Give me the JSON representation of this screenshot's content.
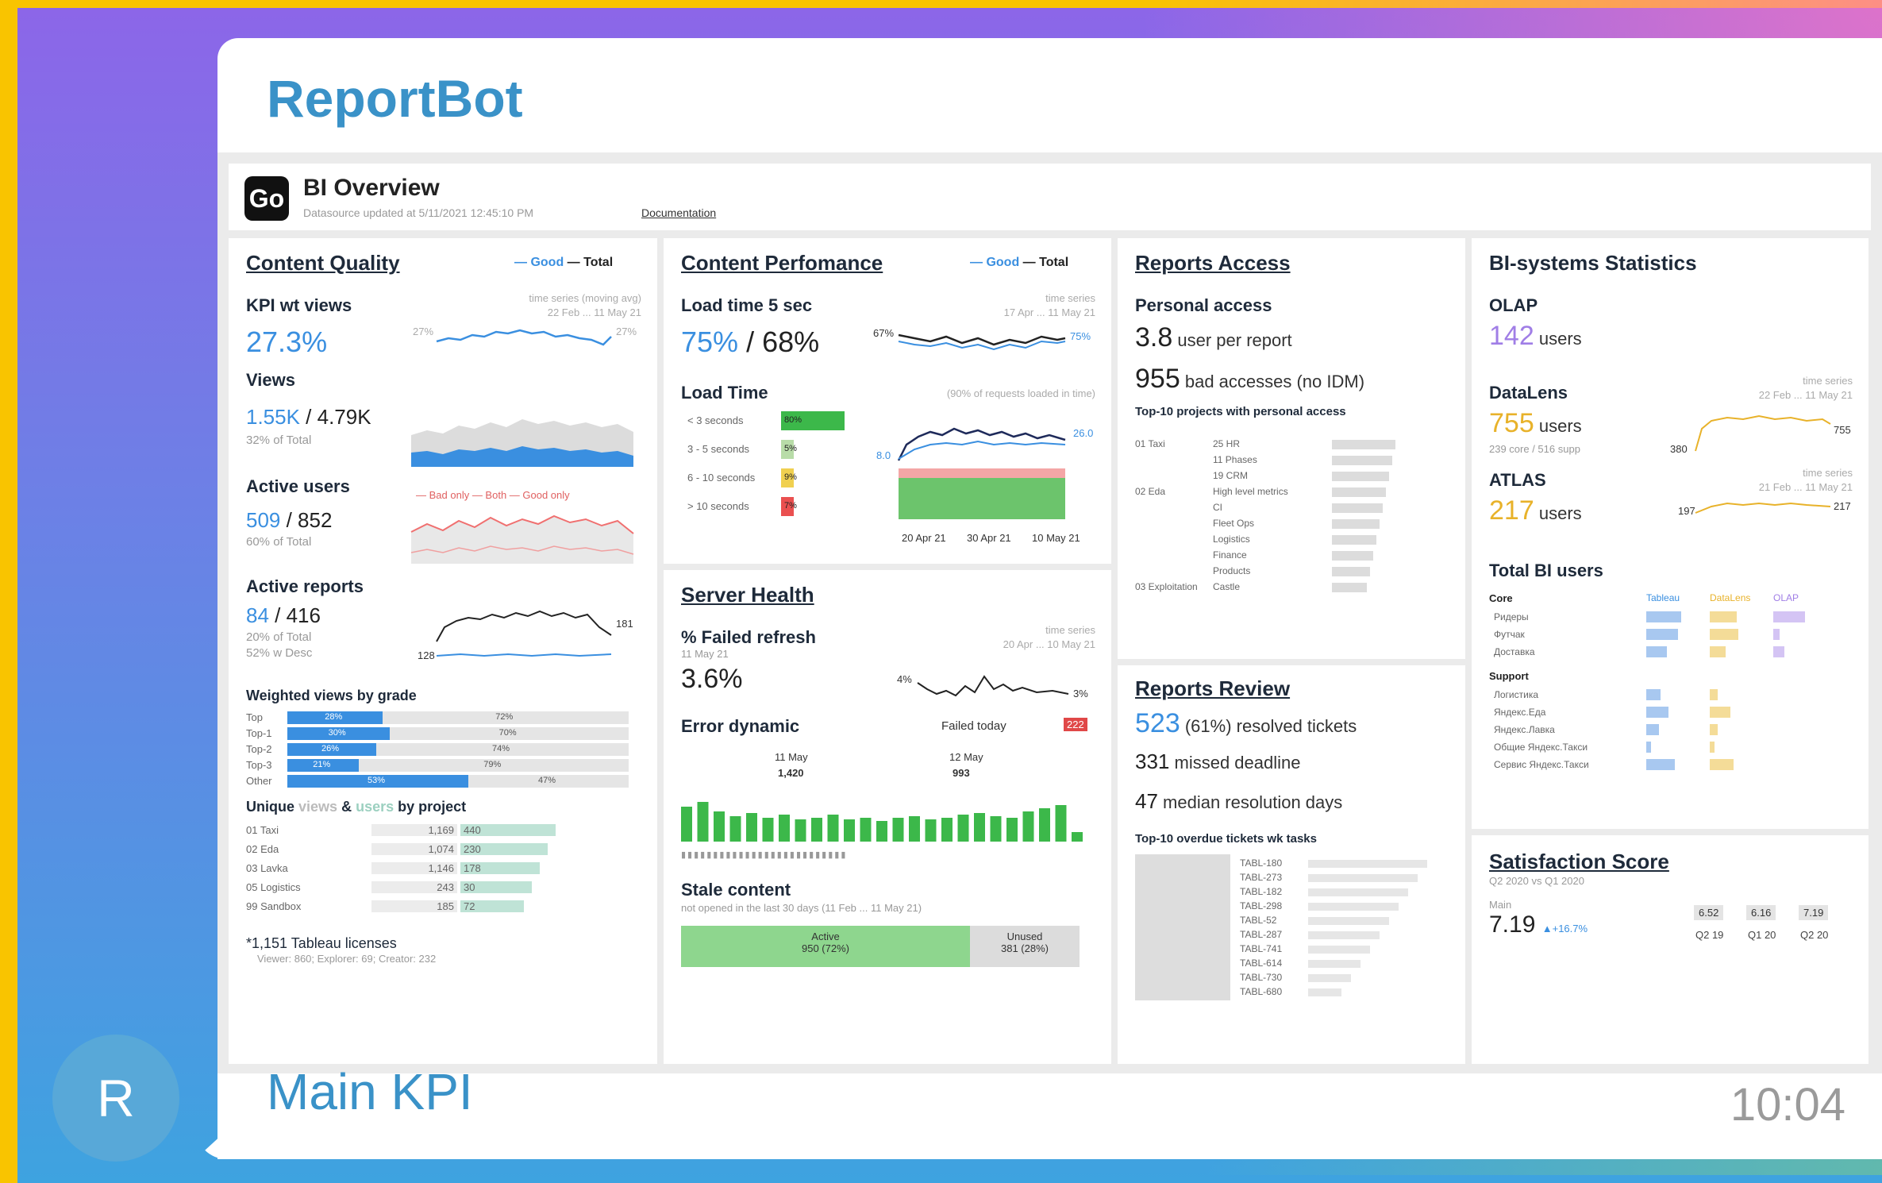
{
  "message": {
    "bot_name": "ReportBot",
    "avatar_letter": "R",
    "caption": "Main KPI",
    "time": "10:04"
  },
  "dashboard": {
    "logo": "Go",
    "title": "BI Overview",
    "subtitle": "Datasource updated at 5/11/2021 12:45:10 PM",
    "doc_link": "Documentation",
    "legend_good": "— Good",
    "legend_total": "— Total"
  },
  "content_quality": {
    "title": "Content Quality",
    "kpi_label": "KPI wt views",
    "kpi_value": "27.3%",
    "kpi_note": "time series (moving avg)",
    "kpi_range": "22 Feb ... 11 May 21",
    "kpi_start": "27%",
    "kpi_end": "27%",
    "views_label": "Views",
    "views_good": "1.55K",
    "views_total": " / 4.79K",
    "views_share": "32% of Total",
    "active_users_label": "Active users",
    "active_users_good": "509",
    "active_users_total": " / 852",
    "active_users_share": "60% of Total",
    "active_users_legend": "— Bad only — Both — Good only",
    "active_reports_label": "Active reports",
    "active_reports_good": "84",
    "active_reports_total": " / 416",
    "active_reports_share": "20% of Total",
    "active_reports_desc": "52% w Desc",
    "active_reports_end": "181",
    "active_reports_end2": "128",
    "grade_title": "Weighted views by grade",
    "grades": [
      {
        "label": "Top",
        "good": "28%",
        "total": "72%",
        "pct": 28
      },
      {
        "label": "Top-1",
        "good": "30%",
        "total": "70%",
        "pct": 30
      },
      {
        "label": "Top-2",
        "good": "26%",
        "total": "74%",
        "pct": 26
      },
      {
        "label": "Top-3",
        "good": "21%",
        "total": "79%",
        "pct": 21
      },
      {
        "label": "Other",
        "good": "53%",
        "total": "47%",
        "pct": 53
      }
    ],
    "unique_title_a": "Unique",
    "unique_title_b": "views",
    "unique_title_c": " & ",
    "unique_title_d": "users",
    "unique_title_e": " by project",
    "projects": [
      {
        "label": "01 Taxi",
        "views": "1,169",
        "users": "440"
      },
      {
        "label": "02 Eda",
        "views": "1,074",
        "users": "230"
      },
      {
        "label": "03 Lavka",
        "views": "1,146",
        "users": "178"
      },
      {
        "label": "05 Logistics",
        "views": "243",
        "users": "30"
      },
      {
        "label": "99 Sandbox",
        "views": "185",
        "users": "72"
      }
    ],
    "license_note": "*1,151 Tableau licenses",
    "license_detail": "Viewer: 860; Explorer: 69; Creator: 232"
  },
  "content_performance": {
    "title": "Content Perfomance",
    "load5_label": "Load time 5 sec",
    "load5_value": "75%",
    "load5_total": " / 68%",
    "load5_note": "time series",
    "load5_range": "17 Apr ... 11 May 21",
    "load5_start": "67%",
    "load5_end": "75%",
    "load_time_label": "Load Time",
    "load_time_note": "(90% of requests loaded in time)",
    "load_buckets": [
      {
        "label": "< 3 seconds",
        "value": "80%",
        "pct": 80,
        "color": "#3cb84a"
      },
      {
        "label": "3 - 5 seconds",
        "value": "5%",
        "pct": 5,
        "color": "#b8dca8"
      },
      {
        "label": "6 - 10 seconds",
        "value": "9%",
        "pct": 9,
        "color": "#f0d050"
      },
      {
        "label": "> 10 seconds",
        "value": "7%",
        "pct": 7,
        "color": "#ea5050"
      }
    ],
    "load_start": "8.0",
    "load_end": "26.0",
    "load_dates": [
      "20 Apr 21",
      "30 Apr 21",
      "10 May 21"
    ]
  },
  "server_health": {
    "title": "Server Health",
    "failed_label": "% Failed refresh",
    "failed_date": "11 May 21",
    "failed_value": "3.6%",
    "failed_note": "time series",
    "failed_range": "20 Apr ... 10 May 21",
    "failed_start": "4%",
    "failed_end": "3%",
    "error_label": "Error dynamic",
    "failed_today": "Failed today",
    "failed_today_value": "222",
    "err_cols": [
      {
        "date": "11 May",
        "value": "1,420"
      },
      {
        "date": "12 May",
        "value": "993"
      }
    ],
    "stale_label": "Stale content",
    "stale_note": "not opened in the last 30 days (11 Feb ... 11 May 21)",
    "stale_active": "Active",
    "stale_active_val": "950 (72%)",
    "stale_unused": "Unused",
    "stale_unused_val": "381 (28%)"
  },
  "reports_access": {
    "title": "Reports Access",
    "personal_label": "Personal access",
    "per_report_value": "3.8",
    "per_report_unit": " user per report",
    "bad_value": "955",
    "bad_unit": " bad accesses (no IDM)",
    "top_title": "Top-10 projects with personal access",
    "groups": [
      "01 Taxi",
      "02 Eda",
      "03 Exploitation"
    ],
    "items": [
      "25 HR",
      "11 Phases",
      "19 CRM",
      "High level metrics",
      "CI",
      "Fleet Ops",
      "Logistics",
      "Finance",
      "Products",
      "Castle"
    ]
  },
  "reports_review": {
    "title": "Reports Review",
    "resolved_value": "523",
    "resolved_pct": " (61%)",
    "resolved_unit": " resolved tickets",
    "missed_value": "331",
    "missed_unit": " missed deadline",
    "median_value": "47",
    "median_unit": " median resolution days",
    "top_title": "Top-10 overdue tickets wk tasks",
    "tickets": [
      "TABL-180",
      "TABL-273",
      "TABL-182",
      "TABL-298",
      "TABL-52",
      "TABL-287",
      "TABL-741",
      "TABL-614",
      "TABL-730",
      "TABL-680"
    ]
  },
  "bi_stats": {
    "title": "BI-systems Statistics",
    "olap_label": "OLAP",
    "olap_value": "142",
    "olap_unit": " users",
    "datalens_label": "DataLens",
    "datalens_value": "755",
    "datalens_unit": " users",
    "datalens_split": "239 core / 516 supp",
    "datalens_note": "time series",
    "datalens_range": "22 Feb ... 11 May 21",
    "datalens_start": "380",
    "datalens_end": "755",
    "atlas_label": "ATLAS",
    "atlas_value": "217",
    "atlas_unit": " users",
    "atlas_note": "time series",
    "atlas_range": "21 Feb ... 11 May 21",
    "atlas_start": "197",
    "atlas_end": "217",
    "total_label": "Total BI users",
    "cols": [
      "Tableau",
      "DataLens",
      "OLAP"
    ],
    "core_label": "Core",
    "core_rows": [
      "Ридеры",
      "Футчак",
      "Доставка"
    ],
    "support_label": "Support",
    "support_rows": [
      "Логистика",
      "Яндекс.Еда",
      "Яндекс.Лавка",
      "Общие Яндекс.Такси",
      "Сервис Яндекс.Такси"
    ]
  },
  "satisfaction": {
    "title": "Satisfaction Score",
    "subtitle": "Q2 2020 vs Q1 2020",
    "main_label": "Main",
    "main_value": "7.19",
    "main_delta": "▲+16.7%",
    "quarters": [
      {
        "value": "6.52",
        "label": "Q2 19"
      },
      {
        "value": "6.16",
        "label": "Q1 20"
      },
      {
        "value": "7.19",
        "label": "Q2 20"
      }
    ]
  },
  "colors": {
    "accent": "#3a92c8",
    "good": "#3a8fe0",
    "green": "#3cb84a",
    "red": "#ea5050"
  }
}
